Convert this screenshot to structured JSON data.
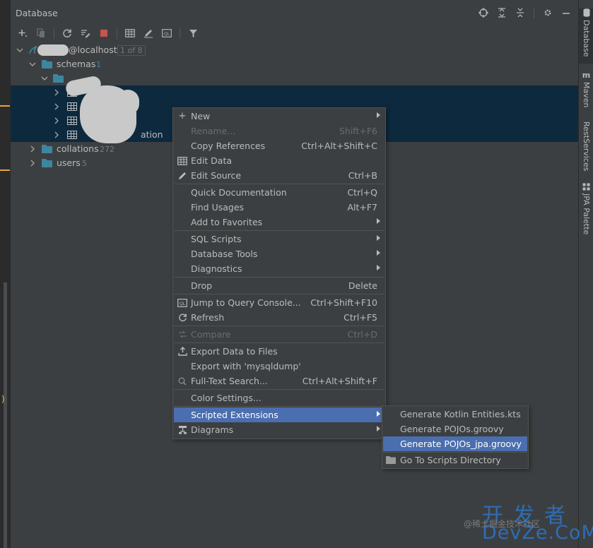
{
  "panel": {
    "title": "Database"
  },
  "colors": {
    "selection": "#0d293e",
    "menu_highlight": "#4b6eaf",
    "folder": "#3e86a0",
    "watermark": "#2d6db5"
  },
  "title_icons": [
    "crosshair-icon",
    "expand-all-icon",
    "collapse-all-icon",
    "gear-icon",
    "minimize-icon"
  ],
  "toolbar": [
    "add-icon",
    "copy-icon",
    "refresh-icon",
    "edit-schema-icon",
    "stop-icon",
    "table-icon",
    "edit-icon",
    "query-console-icon",
    "filter-icon"
  ],
  "tree": {
    "connection": {
      "label": "@localhost",
      "count": "1 of 8"
    },
    "schemas": {
      "label": "schemas",
      "count": "1"
    },
    "table_fragment": "ation",
    "collations": {
      "label": "collations",
      "count": "272"
    },
    "users": {
      "label": "users",
      "count": "5"
    }
  },
  "right_tabs": [
    "Database",
    "Maven",
    "RestServices",
    "JPA Palette"
  ],
  "context_menu": [
    {
      "label": "New",
      "shortcut": "",
      "submenu": true,
      "icon": "plus-icon"
    },
    {
      "label": "Rename...",
      "shortcut": "Shift+F6",
      "disabled": true
    },
    {
      "label": "Copy References",
      "shortcut": "Ctrl+Alt+Shift+C"
    },
    {
      "label": "Edit Data",
      "shortcut": "",
      "icon": "table-icon"
    },
    {
      "label": "Edit Source",
      "shortcut": "Ctrl+B",
      "icon": "pencil-icon"
    },
    {
      "label": "Quick Documentation",
      "shortcut": "Ctrl+Q"
    },
    {
      "label": "Find Usages",
      "shortcut": "Alt+F7"
    },
    {
      "label": "Add to Favorites",
      "shortcut": "",
      "submenu": true
    },
    {
      "label": "SQL Scripts",
      "shortcut": "",
      "submenu": true
    },
    {
      "label": "Database Tools",
      "shortcut": "",
      "submenu": true
    },
    {
      "label": "Diagnostics",
      "shortcut": "",
      "submenu": true
    },
    {
      "label": "Drop",
      "shortcut": "Delete"
    },
    {
      "label": "Jump to Query Console...",
      "shortcut": "Ctrl+Shift+F10",
      "icon": "query-console-icon"
    },
    {
      "label": "Refresh",
      "shortcut": "Ctrl+F5",
      "icon": "refresh-icon"
    },
    {
      "label": "Compare",
      "shortcut": "Ctrl+D",
      "disabled": true,
      "icon": "compare-icon"
    },
    {
      "label": "Export Data to Files",
      "shortcut": "",
      "icon": "export-icon"
    },
    {
      "label": "Export with 'mysqldump'",
      "shortcut": ""
    },
    {
      "label": "Full-Text Search...",
      "shortcut": "Ctrl+Alt+Shift+F",
      "icon": "search-icon"
    },
    {
      "label": "Color Settings...",
      "shortcut": ""
    },
    {
      "label": "Scripted Extensions",
      "shortcut": "",
      "submenu": true,
      "highlighted": true
    },
    {
      "label": "Diagrams",
      "shortcut": "",
      "submenu": true,
      "icon": "diagram-icon"
    }
  ],
  "submenu": [
    {
      "label": "Generate Kotlin Entities.kts"
    },
    {
      "label": "Generate POJOs.groovy"
    },
    {
      "label": "Generate POJOs_jpa.groovy",
      "highlighted": true
    },
    {
      "label": "Go To Scripts Directory",
      "icon": "folder-icon"
    }
  ],
  "watermark": {
    "cn": "开发者",
    "en": "DevZe.CoM",
    "at": "@稀土掘金技术社区"
  },
  "editor_fragment": ")"
}
